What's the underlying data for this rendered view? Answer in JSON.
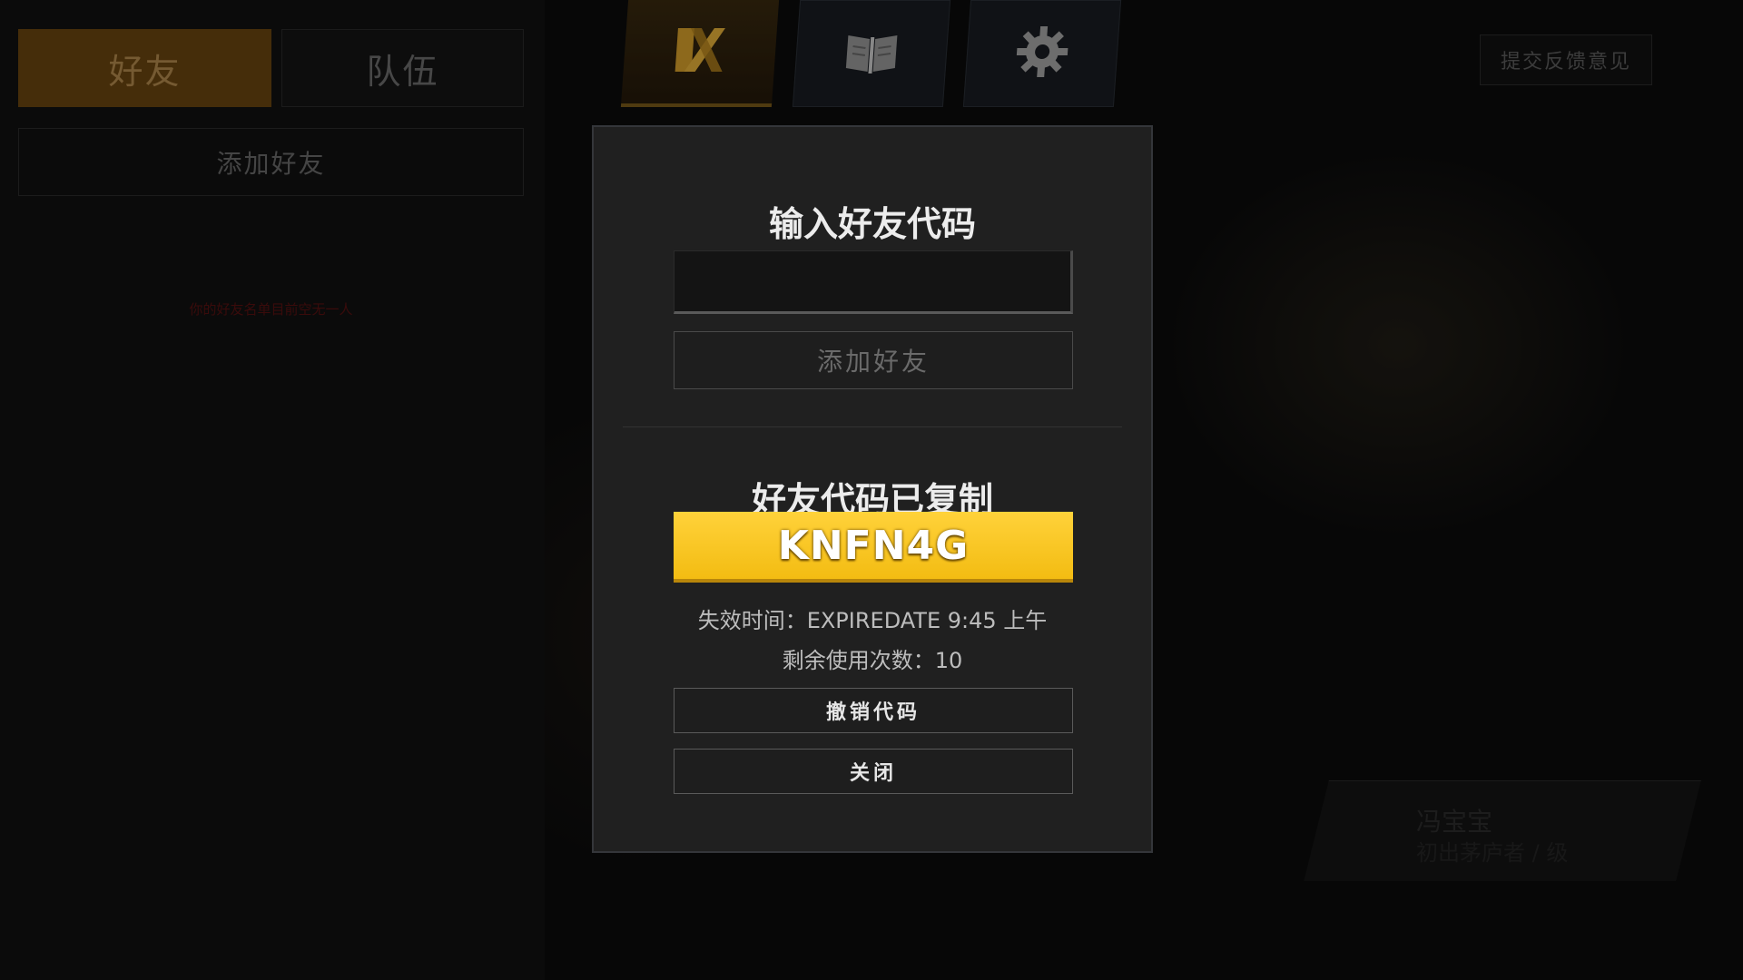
{
  "left_panel": {
    "tabs": [
      {
        "label": "好友",
        "active": true
      },
      {
        "label": "队伍",
        "active": false
      }
    ],
    "add_friend_label": "添加好友",
    "empty_note": "你的好友名单目前空无一人"
  },
  "top_nav": {
    "icons": [
      "play-icon",
      "guide-book-icon",
      "gear-icon"
    ],
    "active_color": "#7a5a1a"
  },
  "feedback": {
    "label": "提交反馈意见"
  },
  "profile_card": {
    "name": "冯宝宝",
    "subtitle": "初出茅庐者 / 级"
  },
  "modal": {
    "enter_code_title": "输入好友代码",
    "code_input_value": "",
    "add_friend_label": "添加好友",
    "copied_title": "好友代码已复制",
    "friend_code": "KNFN4G",
    "expire_line": "失效时间：EXPIREDATE 9:45 上午",
    "remaining_line": "剩余使用次数：10",
    "revoke_label": "撤销代码",
    "close_label": "关闭",
    "code_color": "#f3bc12"
  }
}
